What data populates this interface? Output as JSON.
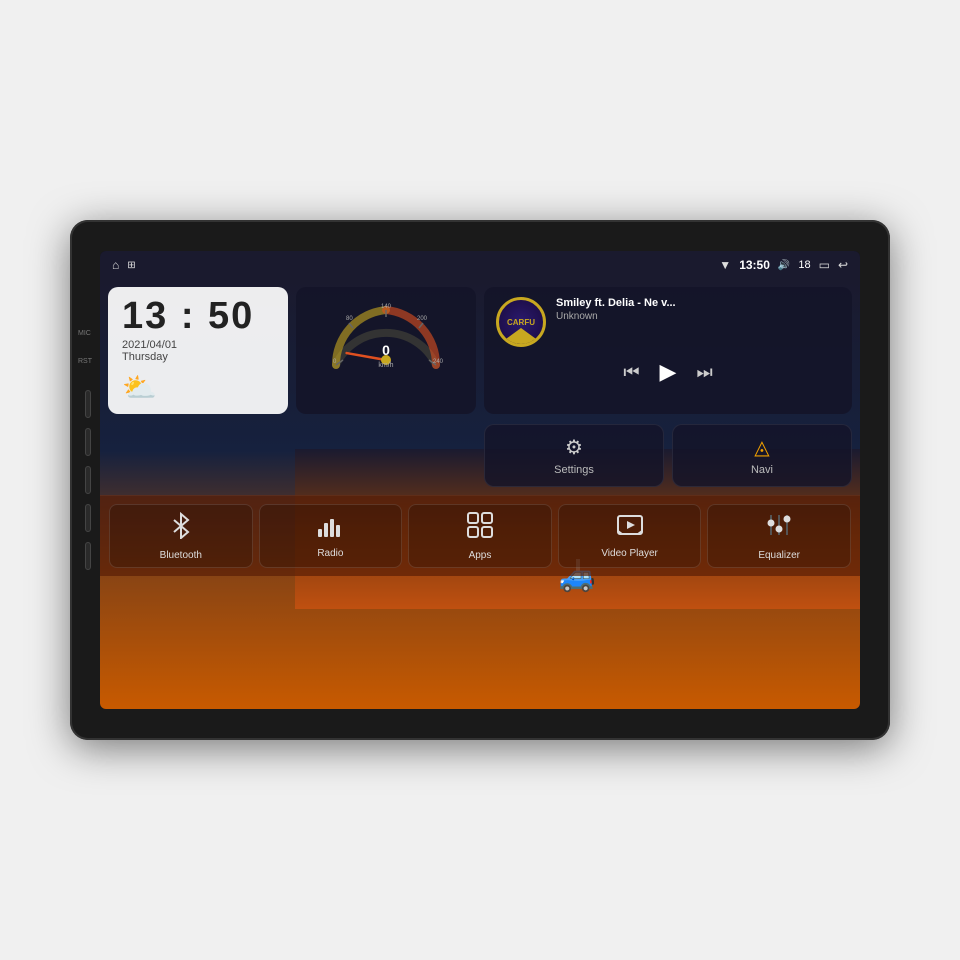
{
  "device": {
    "shell_label": "Car Head Unit"
  },
  "status_bar": {
    "home_icon": "⌂",
    "apps_icon": "⊞",
    "wifi_icon": "▼",
    "time": "13:50",
    "volume_icon": "🔊",
    "volume_value": "18",
    "battery_icon": "▭",
    "back_icon": "↩"
  },
  "clock_widget": {
    "time": "13 : 50",
    "date": "2021/04/01",
    "day": "Thursday",
    "weather_icon": "⛅"
  },
  "speedometer": {
    "speed": "0",
    "unit": "km/h"
  },
  "music_widget": {
    "logo_text": "CARFU",
    "title": "Smiley ft. Delia - Ne v...",
    "artist": "Unknown",
    "prev_icon": "⏮",
    "play_icon": "▶",
    "next_icon": "⏭"
  },
  "action_buttons": [
    {
      "id": "settings",
      "icon": "⚙",
      "label": "Settings"
    },
    {
      "id": "navi",
      "icon": "◮",
      "label": "Navi"
    }
  ],
  "app_bar": [
    {
      "id": "bluetooth",
      "icon": "₿",
      "label": "Bluetooth"
    },
    {
      "id": "radio",
      "icon": "📶",
      "label": "Radio"
    },
    {
      "id": "apps",
      "icon": "⊞",
      "label": "Apps"
    },
    {
      "id": "video-player",
      "icon": "📹",
      "label": "Video Player"
    },
    {
      "id": "equalizer",
      "icon": "⚙",
      "label": "Equalizer"
    }
  ],
  "side_labels": {
    "mic": "MIC",
    "rst": "RST"
  }
}
